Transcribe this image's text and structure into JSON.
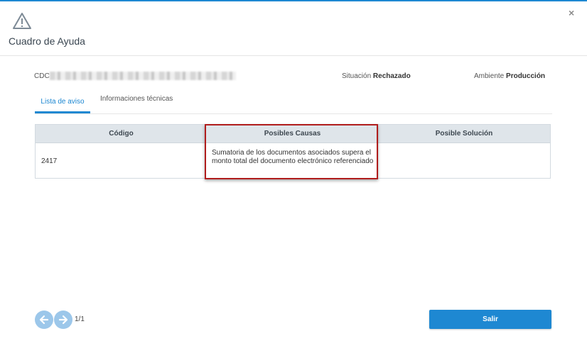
{
  "modal": {
    "title": "Cuadro de Ayuda",
    "close_symbol": "×"
  },
  "info": {
    "cdc_label": "CDC",
    "situacion_label": "Situación",
    "situacion_value": "Rechazado",
    "ambiente_label": "Ambiente",
    "ambiente_value": "Producción"
  },
  "tabs": [
    {
      "label": "Lista de aviso",
      "active": true
    },
    {
      "label": "Informaciones técnicas",
      "active": false
    }
  ],
  "table": {
    "headers": [
      "Código",
      "Posibles Causas",
      "Posible Solución"
    ],
    "rows": [
      {
        "codigo": "2417",
        "causas": "Sumatoria de los documentos asociados supera el monto total del documento electrónico referenciado",
        "solucion": ""
      }
    ]
  },
  "pager": {
    "label": "1/1",
    "prev_icon": "arrow-left-icon",
    "next_icon": "arrow-right-icon"
  },
  "actions": {
    "salir_label": "Salir"
  },
  "colors": {
    "accent": "#1e88d2",
    "highlight_border": "#b01c1c",
    "header_bg": "#dfe5ea"
  }
}
